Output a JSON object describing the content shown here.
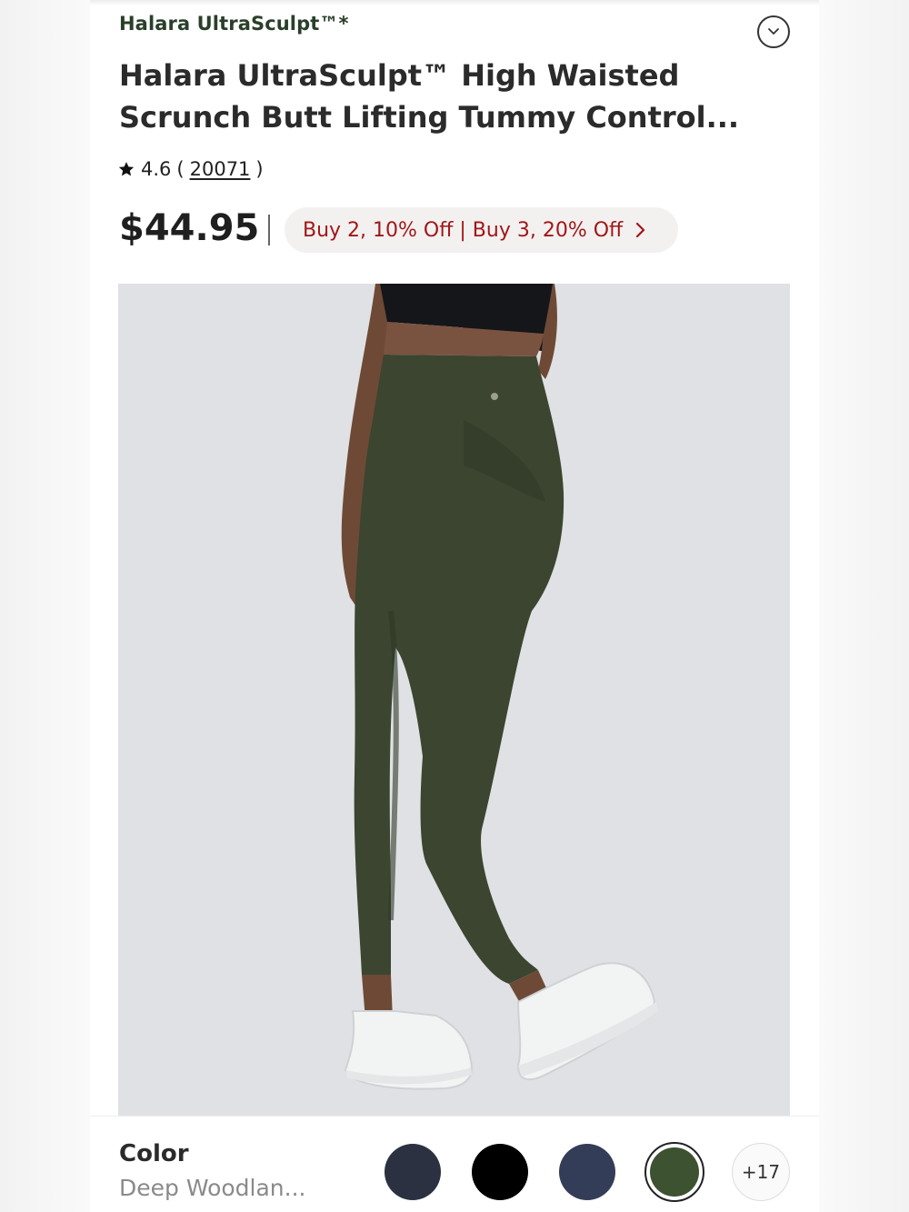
{
  "product": {
    "brand": "Halara UltraSculpt™*",
    "title_line1": "Halara UltraSculpt™ High Waisted",
    "title_line2": "Scrunch Butt Lifting Tummy Control...",
    "rating": "4.6",
    "review_count": "20071",
    "price": "$44.95",
    "promo": "Buy 2, 10% Off | Buy 3, 20% Off",
    "image_alt": "Model wearing dark green high-waisted leggings and white sneakers"
  },
  "icons": {
    "collapse": "chevron-down-icon",
    "star": "star-icon",
    "promo_arrow": "chevron-right-icon"
  },
  "color_selector": {
    "label": "Color",
    "selected_value": "Deep Woodlan...",
    "swatches": [
      {
        "color": "#2b3140"
      },
      {
        "color": "#000000"
      },
      {
        "color": "#343d57"
      },
      {
        "color": "#3d5230",
        "selected": true
      }
    ],
    "more_label": "+17"
  },
  "colors": {
    "brand_text": "#2a3f2a",
    "promo_text": "#a01818",
    "promo_bg": "#f3f0f0",
    "leggings": "#3b4530"
  }
}
